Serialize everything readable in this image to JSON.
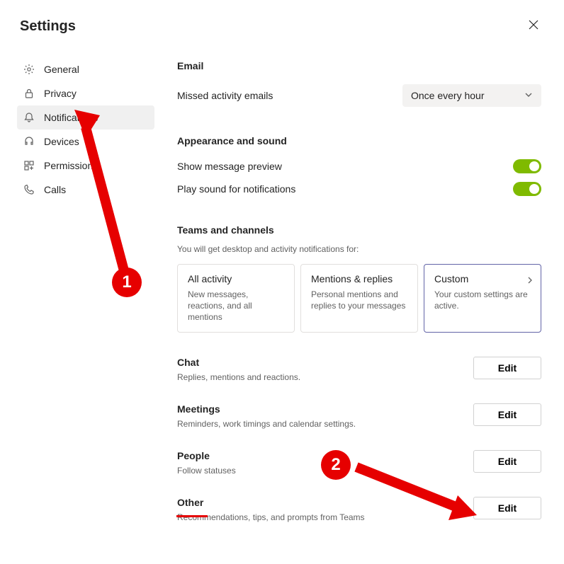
{
  "title": "Settings",
  "sidebar": {
    "items": [
      {
        "label": "General"
      },
      {
        "label": "Privacy"
      },
      {
        "label": "Notifications"
      },
      {
        "label": "Devices"
      },
      {
        "label": "Permissions"
      },
      {
        "label": "Calls"
      }
    ]
  },
  "email": {
    "heading": "Email",
    "missed_label": "Missed activity emails",
    "dropdown_value": "Once every hour"
  },
  "appearance": {
    "heading": "Appearance and sound",
    "row1": "Show message preview",
    "row2": "Play sound for notifications"
  },
  "teams_channels": {
    "heading": "Teams and channels",
    "subtext": "You will get desktop and activity notifications for:",
    "cards": [
      {
        "title": "All activity",
        "desc": "New messages, reactions, and all mentions"
      },
      {
        "title": "Mentions & replies",
        "desc": "Personal mentions and replies to your messages"
      },
      {
        "title": "Custom",
        "desc": "Your custom settings are active."
      }
    ]
  },
  "edit_sections": [
    {
      "heading": "Chat",
      "desc": "Replies, mentions and reactions.",
      "button": "Edit"
    },
    {
      "heading": "Meetings",
      "desc": "Reminders, work timings and calendar settings.",
      "button": "Edit"
    },
    {
      "heading": "People",
      "desc": "Follow statuses",
      "button": "Edit"
    },
    {
      "heading": "Other",
      "desc": "Recommendations, tips, and prompts from Teams",
      "button": "Edit"
    }
  ],
  "annotations": {
    "badge1": "1",
    "badge2": "2"
  }
}
